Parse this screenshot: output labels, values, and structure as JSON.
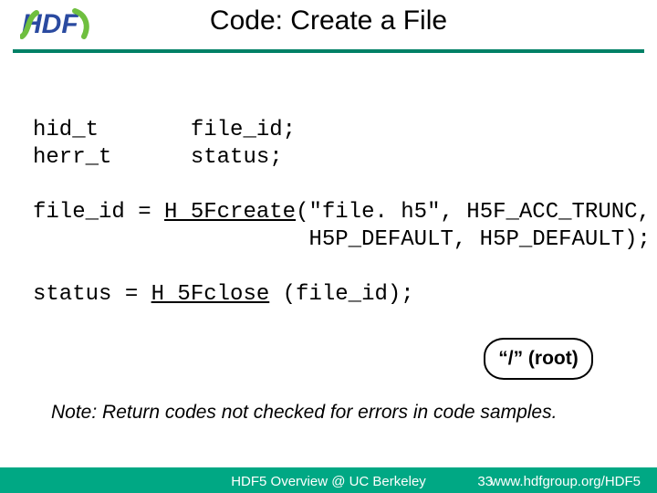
{
  "title": "Code: Create a File",
  "logo": {
    "text_main": "HDF",
    "colors": {
      "blue": "#2a4aa0",
      "green": "#6fbf3f"
    }
  },
  "code": {
    "decl1_type": "hid_t",
    "decl1_var": "file_id;",
    "decl2_type": "herr_t",
    "decl2_var": "status;",
    "line3a": "file_id = ",
    "line3_fn": "H 5Fcreate",
    "line3b": "(\"file. h5\", H5F_ACC_TRUNC,",
    "line4": "                     H5P_DEFAULT, H5P_DEFAULT);",
    "line6a": "status = ",
    "line6_fn": "H 5Fclose",
    "line6b": " (file_id);"
  },
  "root_label": "“/” (root)",
  "note": "Note: Return codes not checked for errors in code samples.",
  "footer": {
    "left": "HDF5 Overview @ UC Berkeley",
    "page": "33",
    "right": "www.hdfgroup.org/HDF5"
  }
}
